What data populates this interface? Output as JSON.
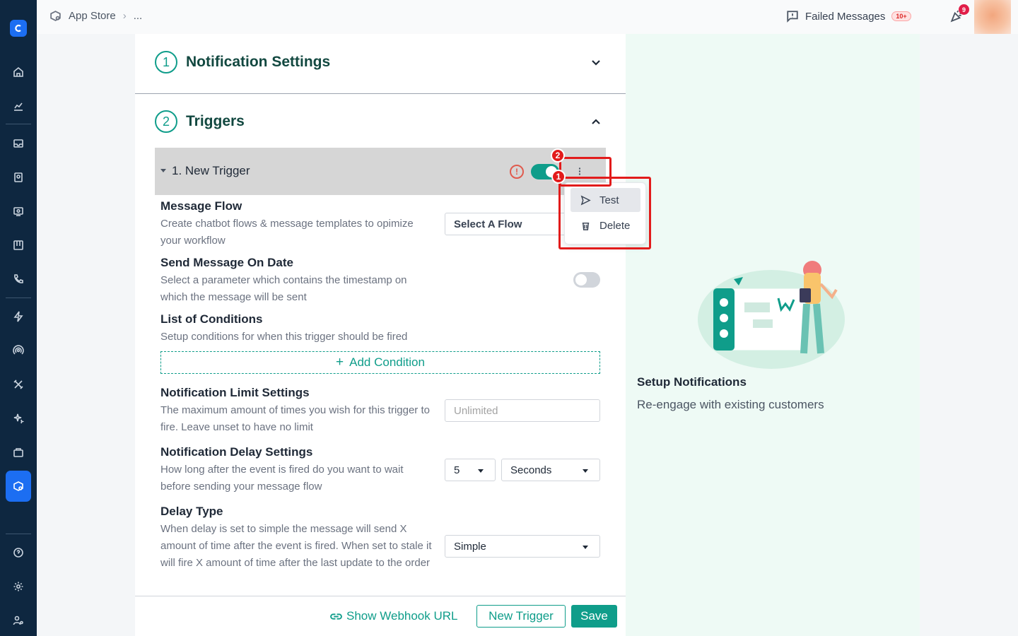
{
  "header": {
    "breadcrumb_root": "App Store",
    "breadcrumb_more": "...",
    "failed_label": "Failed Messages",
    "failed_badge": "10+",
    "notification_count": "9"
  },
  "sections": {
    "notification_settings": {
      "number": "1",
      "title": "Notification Settings"
    },
    "triggers": {
      "number": "2",
      "title": "Triggers"
    }
  },
  "trigger": {
    "label": "1. New Trigger",
    "warning_symbol": "!",
    "enabled": true
  },
  "menu": {
    "items": [
      {
        "label": "Test",
        "icon": "send-icon"
      },
      {
        "label": "Delete",
        "icon": "trash-icon"
      }
    ]
  },
  "annotations": {
    "first": "1",
    "second": "2"
  },
  "form": {
    "message_flow": {
      "title": "Message Flow",
      "desc": "Create chatbot flows & message templates to opimize your workflow",
      "select_value": "Select A Flow"
    },
    "send_on_date": {
      "title": "Send Message On Date",
      "desc": "Select a parameter which contains the timestamp on which the message will be sent",
      "enabled": false
    },
    "conditions": {
      "title": "List of Conditions",
      "desc": "Setup conditions for when this trigger should be fired",
      "add_label": "Add Condition"
    },
    "limit": {
      "title": "Notification Limit Settings",
      "desc": "The maximum amount of times you wish for this trigger to fire. Leave unset to have no limit",
      "placeholder": "Unlimited"
    },
    "delay": {
      "title": "Notification Delay Settings",
      "desc": "How long after the event is fired do you want to wait before sending your message flow",
      "amount": "5",
      "unit": "Seconds"
    },
    "delay_type": {
      "title": "Delay Type",
      "desc": "When delay is set to simple the message will send X amount of time after the event is fired. When set to stale it will fire X amount of time after the last update to the order",
      "value": "Simple"
    }
  },
  "footer": {
    "webhook_label": "Show Webhook URL",
    "new_trigger_label": "New Trigger",
    "save_label": "Save"
  },
  "right_panel": {
    "title": "Setup Notifications",
    "subtitle": "Re-engage with existing customers"
  },
  "colors": {
    "accent": "#0f9d8a",
    "sidebar": "#0e2740",
    "primary": "#1c6ef2",
    "highlight": "#e21b1b"
  }
}
